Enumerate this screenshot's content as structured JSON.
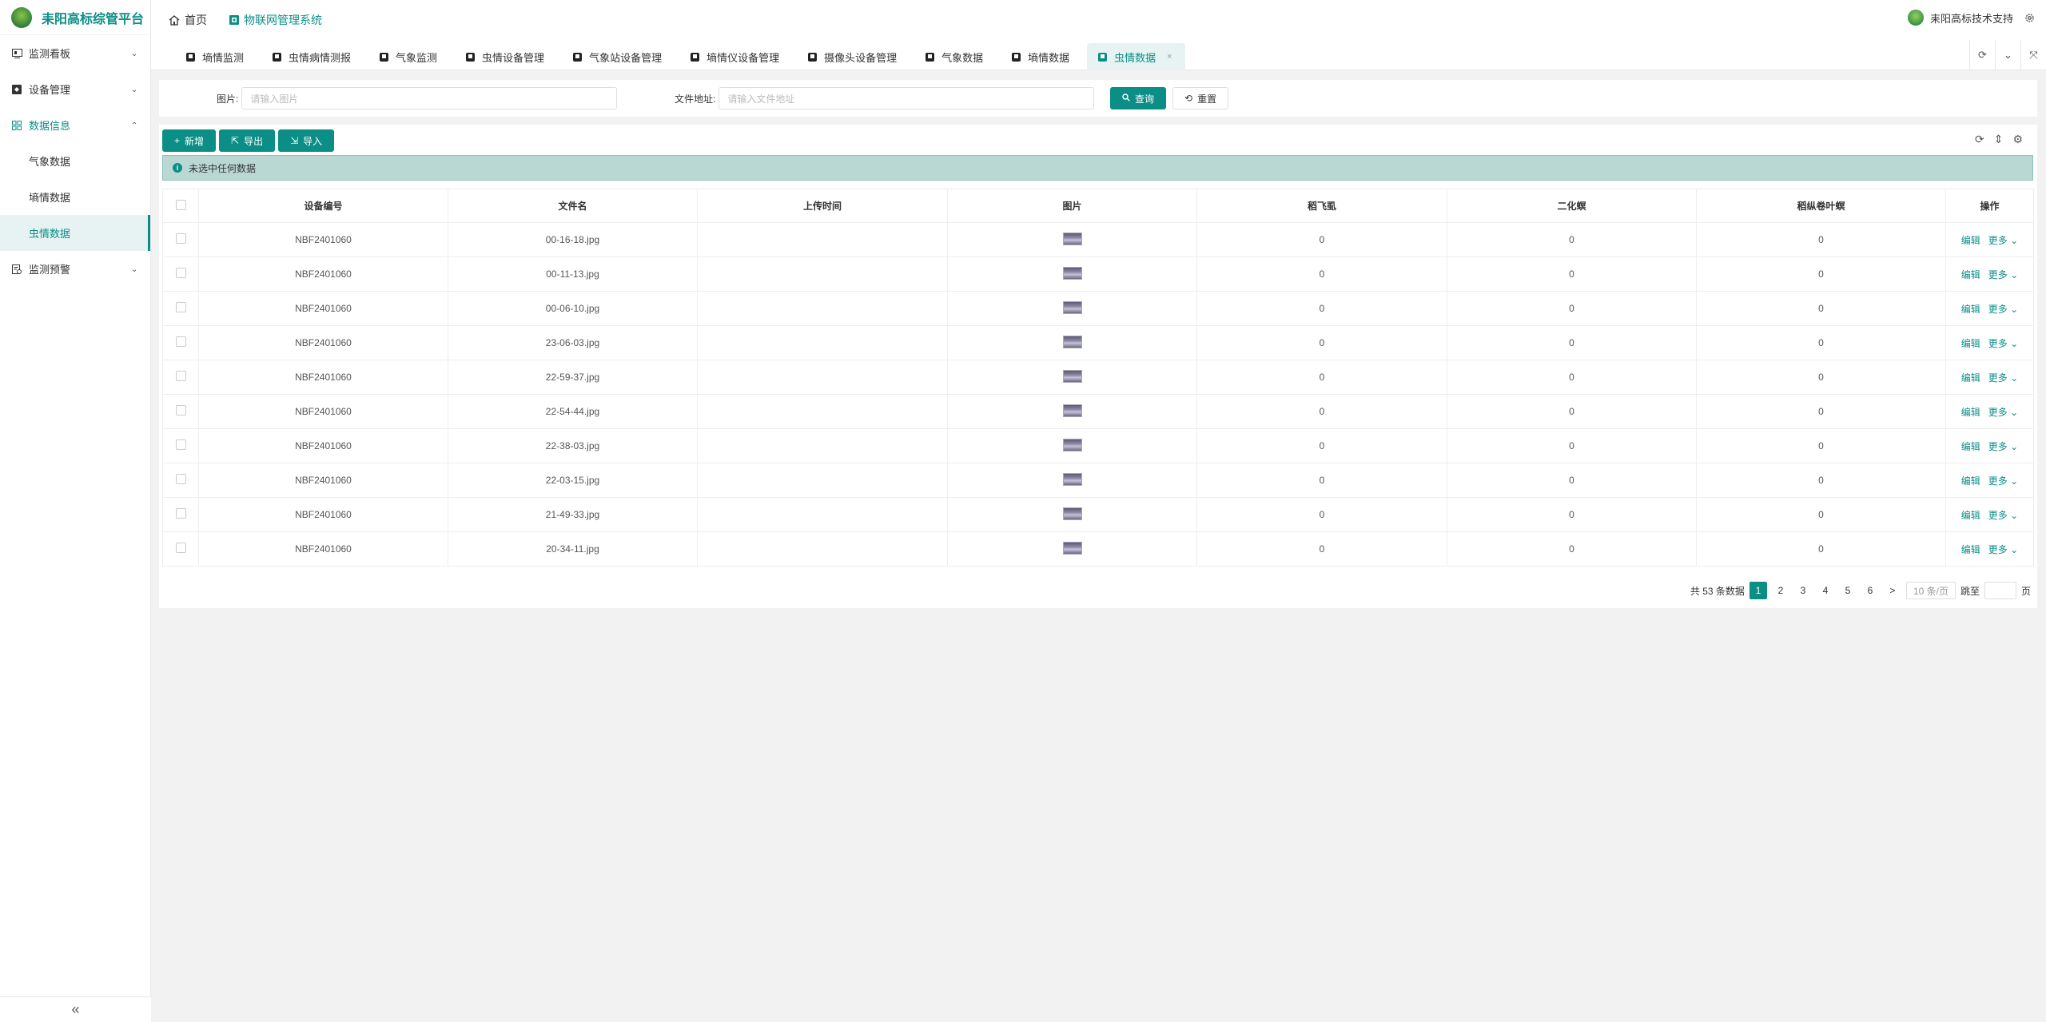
{
  "app": {
    "logo_text": "耒阳高标综管平台",
    "header_nav": [
      {
        "label": "首页",
        "icon": "home-icon"
      },
      {
        "label": "物联网管理系统",
        "icon": "system-icon"
      }
    ],
    "user_name": "耒阳高标技术支持"
  },
  "sidebar": {
    "items": [
      {
        "label": "监测看板",
        "icon": "dashboard-icon"
      },
      {
        "label": "设备管理",
        "icon": "device-icon"
      },
      {
        "label": "数据信息",
        "icon": "data-icon"
      },
      {
        "label": "监测预警",
        "icon": "warning-icon"
      }
    ],
    "subitems": [
      {
        "label": "气象数据"
      },
      {
        "label": "墒情数据"
      },
      {
        "label": "虫情数据"
      }
    ],
    "collapse_label": "«"
  },
  "tabs": [
    {
      "label": "墒情监测"
    },
    {
      "label": "虫情病情测报"
    },
    {
      "label": "气象监测"
    },
    {
      "label": "虫情设备管理"
    },
    {
      "label": "气象站设备管理"
    },
    {
      "label": "墒情仪设备管理"
    },
    {
      "label": "摄像头设备管理"
    },
    {
      "label": "气象数据"
    },
    {
      "label": "墒情数据"
    },
    {
      "label": "虫情数据",
      "close": "×"
    }
  ],
  "search": {
    "image_label": "图片:",
    "image_placeholder": "请输入图片",
    "address_label": "文件地址:",
    "address_placeholder": "请输入文件地址",
    "query_button": "查询",
    "reset_button": "重置"
  },
  "toolbar": {
    "add": "新增",
    "export": "导出",
    "import": "导入"
  },
  "alert": {
    "icon": "i",
    "text": "未选中任何数据"
  },
  "table": {
    "headers": [
      "设备编号",
      "文件名",
      "上传时间",
      "图片",
      "稻飞虱",
      "二化螟",
      "稻纵卷叶螟",
      "操作"
    ],
    "edit_label": "编辑",
    "more_label": "更多",
    "rows": [
      {
        "device": "NBF2401060",
        "file": "00-16-18.jpg",
        "time": "",
        "v1": "0",
        "v2": "0",
        "v3": "0"
      },
      {
        "device": "NBF2401060",
        "file": "00-11-13.jpg",
        "time": "",
        "v1": "0",
        "v2": "0",
        "v3": "0"
      },
      {
        "device": "NBF2401060",
        "file": "00-06-10.jpg",
        "time": "",
        "v1": "0",
        "v2": "0",
        "v3": "0"
      },
      {
        "device": "NBF2401060",
        "file": "23-06-03.jpg",
        "time": "",
        "v1": "0",
        "v2": "0",
        "v3": "0"
      },
      {
        "device": "NBF2401060",
        "file": "22-59-37.jpg",
        "time": "",
        "v1": "0",
        "v2": "0",
        "v3": "0"
      },
      {
        "device": "NBF2401060",
        "file": "22-54-44.jpg",
        "time": "",
        "v1": "0",
        "v2": "0",
        "v3": "0"
      },
      {
        "device": "NBF2401060",
        "file": "22-38-03.jpg",
        "time": "",
        "v1": "0",
        "v2": "0",
        "v3": "0"
      },
      {
        "device": "NBF2401060",
        "file": "22-03-15.jpg",
        "time": "",
        "v1": "0",
        "v2": "0",
        "v3": "0"
      },
      {
        "device": "NBF2401060",
        "file": "21-49-33.jpg",
        "time": "",
        "v1": "0",
        "v2": "0",
        "v3": "0"
      },
      {
        "device": "NBF2401060",
        "file": "20-34-11.jpg",
        "time": "",
        "v1": "0",
        "v2": "0",
        "v3": "0"
      }
    ]
  },
  "pagination": {
    "total": "共 53 条数据",
    "pages": [
      "1",
      "2",
      "3",
      "4",
      "5",
      "6"
    ],
    "next": ">",
    "page_size": "10 条/页",
    "jump_label": "跳至",
    "page_suffix": "页"
  },
  "colors": {
    "accent": "#0b8e86",
    "alert_bg": "#b9d8d3"
  }
}
